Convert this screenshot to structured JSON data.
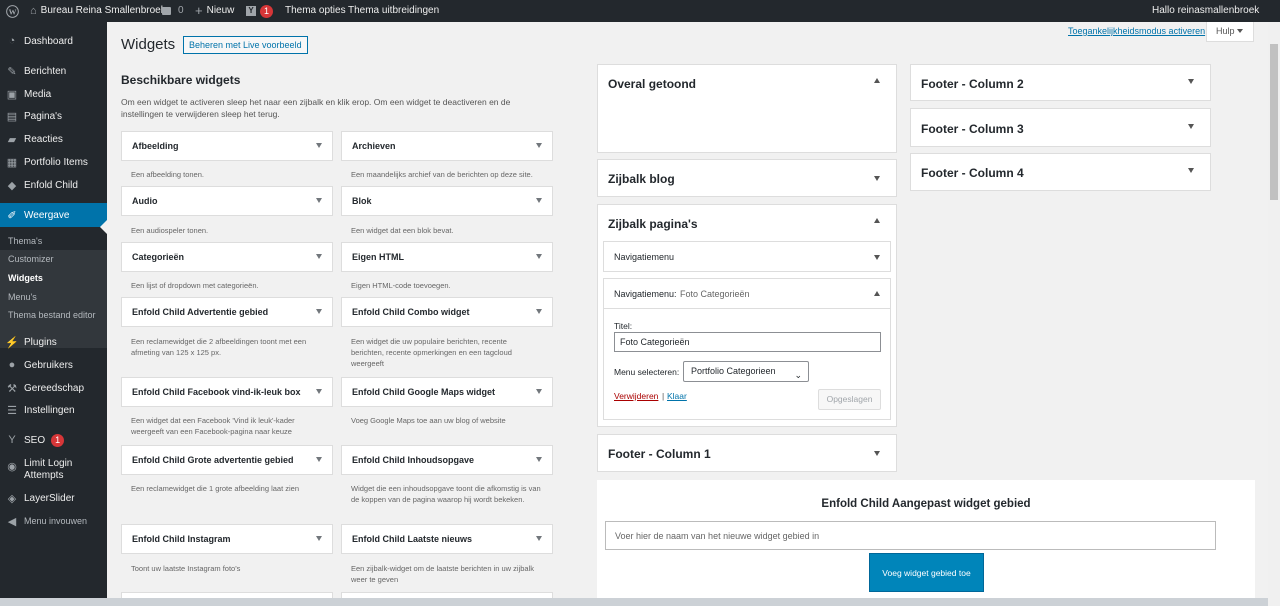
{
  "admin_bar": {
    "site": "Bureau Reina Smallenbroek",
    "comments": "0",
    "new": "Nieuw",
    "updates": "1",
    "theme_options": "Thema opties",
    "theme_extensions": "Thema uitbreidingen",
    "greeting": "Hallo reinasmallenbroek"
  },
  "menu": {
    "items": [
      {
        "id": "dashboard",
        "label": "Dashboard",
        "icon": "dashboard-icon"
      },
      {
        "id": "berichten",
        "label": "Berichten",
        "icon": "pin-icon"
      },
      {
        "id": "media",
        "label": "Media",
        "icon": "media-icon"
      },
      {
        "id": "paginas",
        "label": "Pagina's",
        "icon": "pages-icon"
      },
      {
        "id": "reacties",
        "label": "Reacties",
        "icon": "comments-icon"
      },
      {
        "id": "portfolio",
        "label": "Portfolio Items",
        "icon": "portfolio-icon"
      },
      {
        "id": "enfold",
        "label": "Enfold Child",
        "icon": "enfold-icon"
      },
      {
        "id": "weergave",
        "label": "Weergave",
        "icon": "brush-icon"
      },
      {
        "id": "plugins",
        "label": "Plugins",
        "icon": "plugin-icon"
      },
      {
        "id": "gebruikers",
        "label": "Gebruikers",
        "icon": "users-icon"
      },
      {
        "id": "gereedschap",
        "label": "Gereedschap",
        "icon": "wrench-icon"
      },
      {
        "id": "instellingen",
        "label": "Instellingen",
        "icon": "settings-icon"
      },
      {
        "id": "seo",
        "label": "SEO",
        "icon": "seo-icon",
        "badge": "1"
      },
      {
        "id": "limitlogin",
        "label": "Limit Login Attempts",
        "icon": "lock-icon"
      },
      {
        "id": "layerslider",
        "label": "LayerSlider",
        "icon": "layers-icon"
      },
      {
        "id": "collapse",
        "label": "Menu invouwen",
        "icon": "collapse-icon"
      }
    ],
    "submenu": [
      "Thema's",
      "Customizer",
      "Widgets",
      "Menu's",
      "Thema bestand editor"
    ]
  },
  "header": {
    "title": "Widgets",
    "live_button": "Beheren met Live voorbeeld",
    "accessibility": "Toegankelijkheidsmodus activeren",
    "help": "Hulp"
  },
  "available": {
    "title": "Beschikbare widgets",
    "description": "Om een widget te activeren sleep het naar een zijbalk en klik erop. Om een widget te deactiveren en de instellingen te verwijderen sleep het terug.",
    "widgets": [
      {
        "name": "Afbeelding",
        "desc": "Een afbeelding tonen."
      },
      {
        "name": "Archieven",
        "desc": "Een maandelijks archief van de berichten op deze site."
      },
      {
        "name": "Audio",
        "desc": "Een audiospeler tonen."
      },
      {
        "name": "Blok",
        "desc": "Een widget dat een blok bevat."
      },
      {
        "name": "Categorieën",
        "desc": "Een lijst of dropdown met categorieën."
      },
      {
        "name": "Eigen HTML",
        "desc": "Eigen HTML-code toevoegen."
      },
      {
        "name": "Enfold Child Advertentie gebied",
        "desc": "Een reclamewidget die 2 afbeeldingen toont met een afmeting van 125 x 125 px."
      },
      {
        "name": "Enfold Child Combo widget",
        "desc": "Een widget die uw populaire berichten, recente berichten, recente opmerkingen en een tagcloud weergeeft"
      },
      {
        "name": "Enfold Child Facebook vind-ik-leuk box",
        "desc": "Een widget dat een Facebook 'Vind ik leuk'-kader weergeeft van een Facebook-pagina naar keuze"
      },
      {
        "name": "Enfold Child Google Maps widget",
        "desc": "Voeg Google Maps toe aan uw blog of website"
      },
      {
        "name": "Enfold Child Grote advertentie gebied",
        "desc": "Een reclamewidget die 1 grote afbeelding laat zien"
      },
      {
        "name": "Enfold Child Inhoudsopgave",
        "desc": "Widget die een inhoudsopgave toont die afkomstig is van de koppen van de pagina waarop hij wordt bekeken."
      },
      {
        "name": "Enfold Child Instagram",
        "desc": "Toont uw laatste Instagram foto's"
      },
      {
        "name": "Enfold Child Laatste nieuws",
        "desc": "Een zijbalk-widget om de laatste berichten in uw zijbalk weer te geven"
      }
    ]
  },
  "areas": {
    "overal": "Overal getoond",
    "zijbalk_blog": "Zijbalk blog",
    "zijbalk_paginas": "Zijbalk pagina's",
    "footer1": "Footer - Column 1",
    "footer2": "Footer - Column 2",
    "footer3": "Footer - Column 3",
    "footer4": "Footer - Column 4"
  },
  "nav_widget": {
    "collapsed": "Navigatiemenu",
    "expanded_prefix": "Navigatiemenu:",
    "expanded_title": "Foto Categorieën",
    "title_label": "Titel:",
    "title_value": "Foto Categorieën",
    "menu_label": "Menu selecteren:",
    "menu_value": "Portfolio Categorieen",
    "delete": "Verwijderen",
    "separator": "|",
    "done": "Klaar",
    "saved": "Opgeslagen"
  },
  "custom_area": {
    "title": "Enfold Child Aangepast widget gebied",
    "placeholder": "Voer hier de naam van het nieuwe widget gebied in",
    "button": "Voeg widget gebied toe"
  },
  "colors": {
    "admin_bg": "#23282d",
    "active": "#0073aa",
    "primary_btn": "#0085ba"
  }
}
